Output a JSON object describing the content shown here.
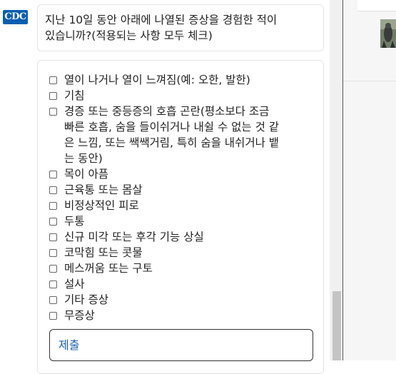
{
  "logo": {
    "text": "CDC"
  },
  "question": {
    "line1": "지난 10일 동안 아래에 나열된 증상을 경험한 적이",
    "line2": "있습니까?(적용되는 사항 모두 체크)"
  },
  "options": [
    {
      "lines": [
        "열이 나거나 열이 느껴짐(예: 오한, 발한)"
      ]
    },
    {
      "lines": [
        "기침"
      ]
    },
    {
      "lines": [
        "경증 또는 중등증의 호흡 곤란(평소보다 조금",
        "빠른 호흡, 숨을 들이쉬거나 내쉴 수 없는 것 같",
        "은 느낌, 또는 쌕쌕거림, 특히 숨을 내쉬거나 뱉",
        "는 동안)"
      ]
    },
    {
      "lines": [
        "목이 아픔"
      ]
    },
    {
      "lines": [
        "근육통 또는 몸살"
      ]
    },
    {
      "lines": [
        "비정상적인 피로"
      ]
    },
    {
      "lines": [
        "두통"
      ]
    },
    {
      "lines": [
        "신규 미각 또는 후각 기능 상실"
      ]
    },
    {
      "lines": [
        "코막힘 또는 콧물"
      ]
    },
    {
      "lines": [
        "메스꺼움 또는 구토"
      ]
    },
    {
      "lines": [
        "설사"
      ]
    },
    {
      "lines": [
        "기타 증상"
      ]
    },
    {
      "lines": [
        "무증상"
      ]
    }
  ],
  "submit": {
    "label": "제출"
  },
  "colors": {
    "brand": "#0b5eb0",
    "submit_text": "#1a5fb4"
  }
}
